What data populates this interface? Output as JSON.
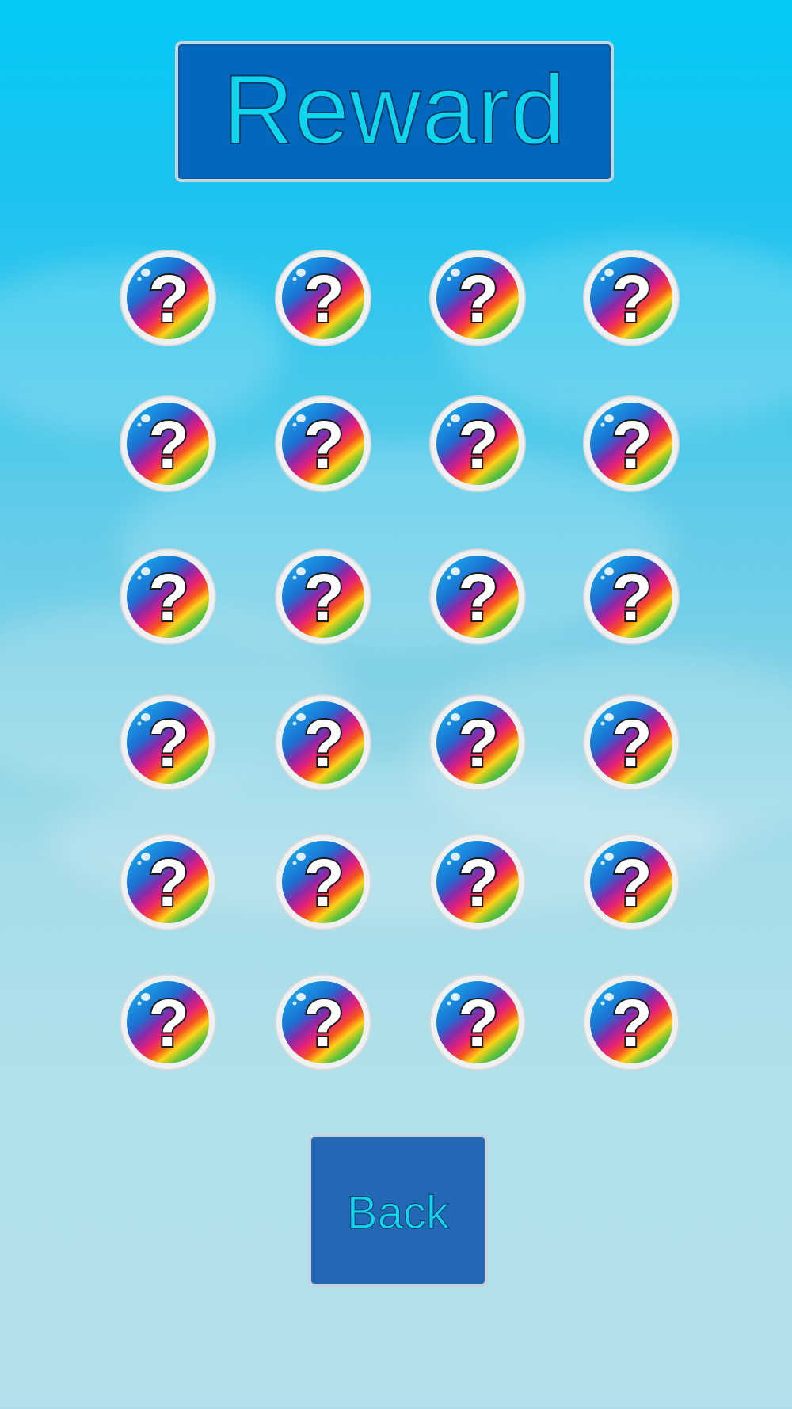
{
  "title": "Reward",
  "back_label": "Back",
  "reward_slots": {
    "rows": 6,
    "columns": 4,
    "icon": "locked-mystery-reward-icon",
    "glyph": "?"
  },
  "colors": {
    "title_box": "#0268bd",
    "title_text": "#0fd6ee",
    "back_button": "#2268b4",
    "back_text": "#13d3ee",
    "sky_top": "#04c9f7",
    "sky_bottom": "#b1e0e9"
  }
}
